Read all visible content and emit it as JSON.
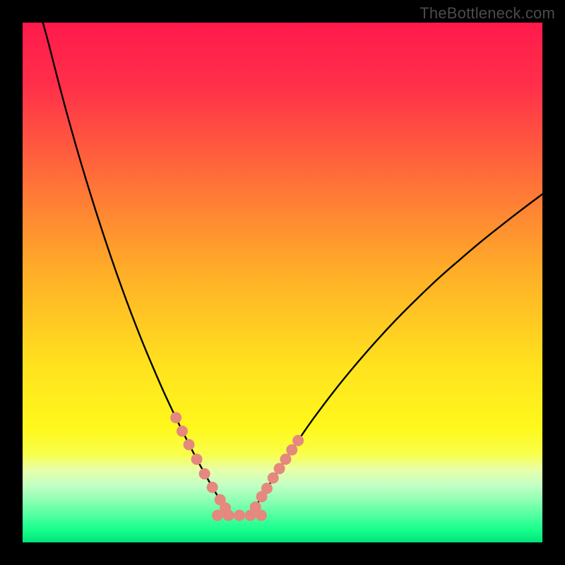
{
  "watermark": "TheBottleneck.com",
  "chart_data": {
    "type": "line",
    "title": "",
    "xlabel": "",
    "ylabel": "",
    "xlim": [
      0,
      100
    ],
    "ylim": [
      0,
      100
    ],
    "grid": false,
    "legend": false,
    "gradient_stops": [
      {
        "offset": 0.0,
        "color": "#ff1a4b"
      },
      {
        "offset": 0.12,
        "color": "#ff2f4a"
      },
      {
        "offset": 0.3,
        "color": "#ff6f39"
      },
      {
        "offset": 0.48,
        "color": "#ffae28"
      },
      {
        "offset": 0.66,
        "color": "#ffe21e"
      },
      {
        "offset": 0.78,
        "color": "#fff81c"
      },
      {
        "offset": 0.83,
        "color": "#f8ff4a"
      },
      {
        "offset": 0.86,
        "color": "#e8ffa8"
      },
      {
        "offset": 0.89,
        "color": "#c3ffc4"
      },
      {
        "offset": 0.92,
        "color": "#8cffb2"
      },
      {
        "offset": 0.95,
        "color": "#4dffa0"
      },
      {
        "offset": 0.975,
        "color": "#18ff8c"
      },
      {
        "offset": 1.0,
        "color": "#00e37a"
      }
    ],
    "series": [
      {
        "name": "left-curve",
        "stroke": "#000000",
        "x": [
          3.9,
          5,
          7,
          9,
          11,
          13,
          15,
          17,
          19,
          21,
          23,
          25,
          27,
          29,
          31,
          33,
          35,
          37,
          38.5
        ],
        "y": [
          100,
          96,
          88.2,
          80.8,
          73.8,
          67.2,
          60.9,
          54.9,
          49.2,
          43.8,
          38.7,
          33.9,
          29.3,
          25.0,
          20.9,
          17.0,
          13.3,
          9.8,
          7.3
        ]
      },
      {
        "name": "right-curve",
        "stroke": "#000000",
        "x": [
          45.0,
          47,
          50,
          53,
          56,
          60,
          64,
          68,
          72,
          76,
          80,
          84,
          88,
          92,
          96,
          100
        ],
        "y": [
          7.2,
          10.4,
          15.1,
          19.6,
          23.9,
          29.2,
          34.1,
          38.7,
          43.0,
          47.0,
          50.8,
          54.3,
          57.7,
          60.9,
          64.0,
          67.0
        ]
      }
    ],
    "markers": [
      {
        "name": "left-band-markers",
        "color": "#e5887e",
        "radius_px": 8,
        "points": [
          {
            "x": 29.5,
            "y": 24.0
          },
          {
            "x": 30.7,
            "y": 21.4
          },
          {
            "x": 32.0,
            "y": 18.8
          },
          {
            "x": 33.5,
            "y": 16.0
          },
          {
            "x": 35.0,
            "y": 13.2
          },
          {
            "x": 36.5,
            "y": 10.6
          },
          {
            "x": 38.0,
            "y": 8.2
          },
          {
            "x": 39.0,
            "y": 6.6
          }
        ]
      },
      {
        "name": "bottom-flat-markers",
        "color": "#e5887e",
        "radius_px": 8,
        "points": [
          {
            "x": 37.5,
            "y": 5.2
          },
          {
            "x": 39.6,
            "y": 5.2
          },
          {
            "x": 41.7,
            "y": 5.2
          },
          {
            "x": 43.8,
            "y": 5.2
          },
          {
            "x": 45.9,
            "y": 5.2
          }
        ]
      },
      {
        "name": "right-band-markers",
        "color": "#e5887e",
        "radius_px": 8,
        "points": [
          {
            "x": 44.8,
            "y": 6.8
          },
          {
            "x": 46.0,
            "y": 8.8
          },
          {
            "x": 47.0,
            "y": 10.4
          },
          {
            "x": 48.2,
            "y": 12.4
          },
          {
            "x": 49.4,
            "y": 14.2
          },
          {
            "x": 50.6,
            "y": 16.0
          },
          {
            "x": 51.8,
            "y": 17.8
          },
          {
            "x": 53.0,
            "y": 19.6
          }
        ]
      }
    ]
  }
}
